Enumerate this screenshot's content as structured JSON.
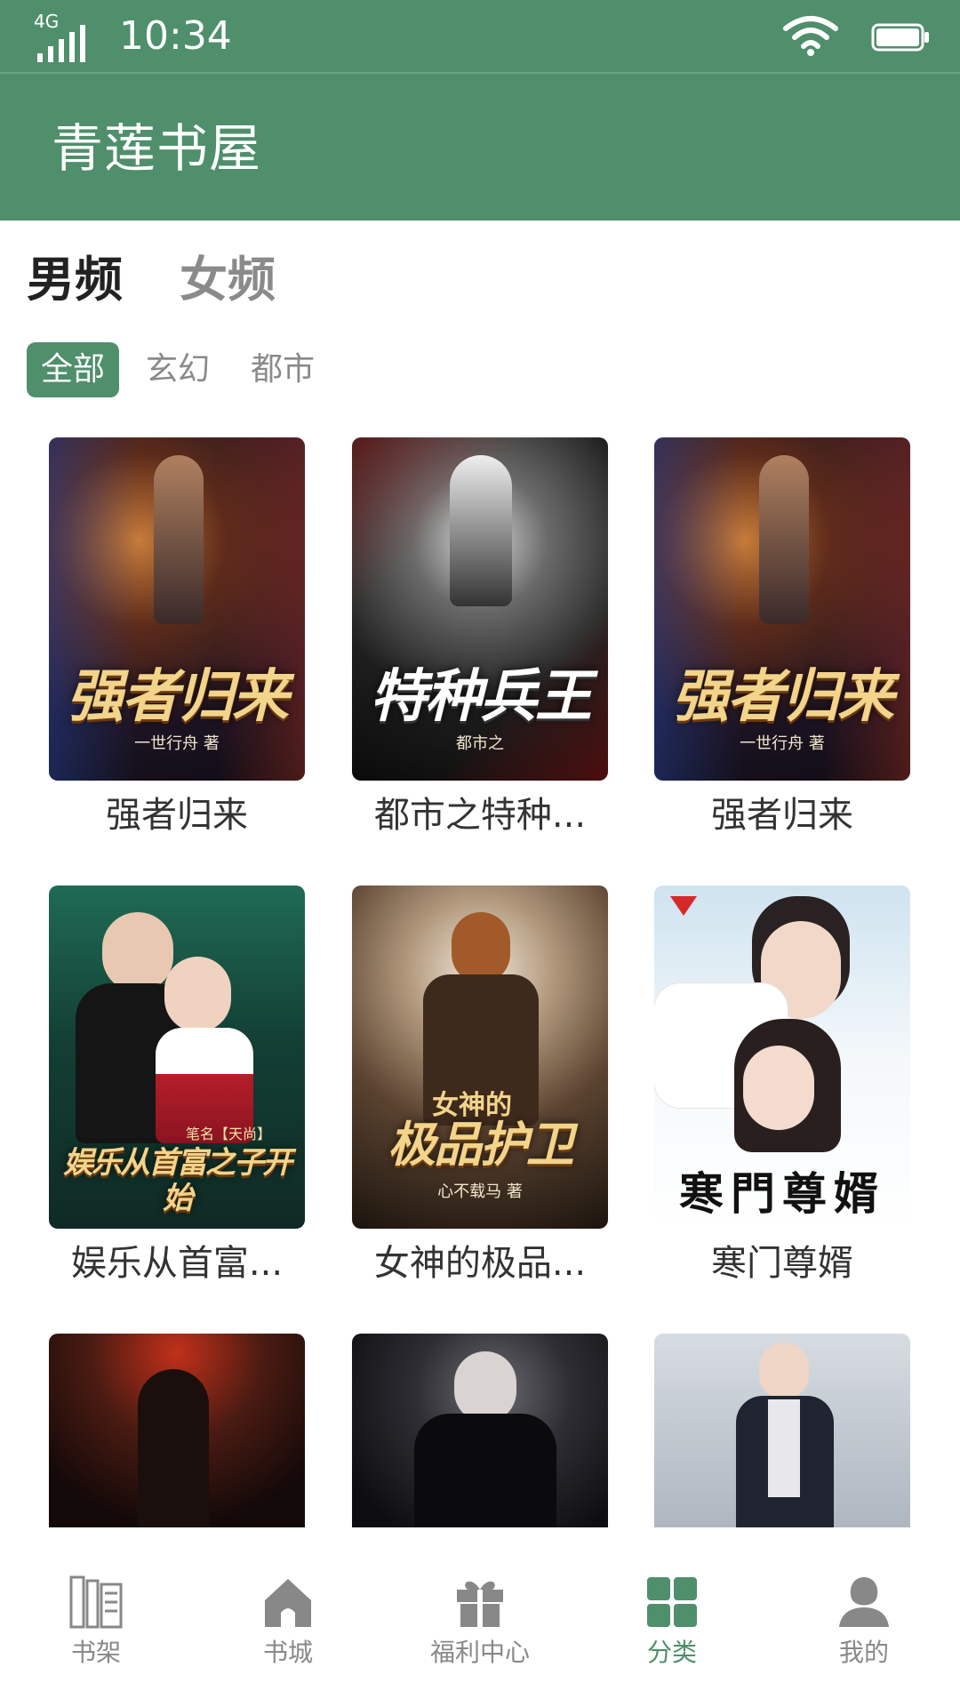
{
  "status_bar": {
    "network": "4G",
    "time": "10:34"
  },
  "app": {
    "title": "青莲书屋",
    "accent_color": "#4f8f6c"
  },
  "gender_tabs": [
    {
      "label": "男频",
      "selected": true
    },
    {
      "label": "女频",
      "selected": false
    }
  ],
  "categories": [
    {
      "label": "全部",
      "selected": true
    },
    {
      "label": "玄幻",
      "selected": false
    },
    {
      "label": "都市",
      "selected": false
    }
  ],
  "books": [
    {
      "name": "强者归来",
      "cover_title": "强者归来",
      "cover_author": "一世行舟 著"
    },
    {
      "name": "都市之特种...",
      "cover_title": "特种兵王",
      "cover_author": "都市之"
    },
    {
      "name": "强者归来",
      "cover_title": "强者归来",
      "cover_author": "一世行舟 著"
    },
    {
      "name": "娱乐从首富...",
      "cover_title": "娱乐从首富之子开始",
      "cover_author": "笔名【天尚】"
    },
    {
      "name": "女神的极品...",
      "cover_title": "极品护卫",
      "cover_author": "心不载马 著",
      "cover_sub": "女神的"
    },
    {
      "name": "寒门尊婿",
      "cover_title": "寒門尊婿",
      "cover_author": ""
    },
    {
      "name": "",
      "cover_title": "",
      "cover_author": ""
    },
    {
      "name": "",
      "cover_title": "",
      "cover_author": ""
    },
    {
      "name": "",
      "cover_title": "",
      "cover_author": ""
    }
  ],
  "bottom_nav": [
    {
      "label": "书架",
      "icon": "bookshelf-icon",
      "active": false
    },
    {
      "label": "书城",
      "icon": "home-icon",
      "active": false
    },
    {
      "label": "福利中心",
      "icon": "gift-icon",
      "active": false
    },
    {
      "label": "分类",
      "icon": "category-grid-icon",
      "active": true
    },
    {
      "label": "我的",
      "icon": "profile-icon",
      "active": false
    }
  ]
}
